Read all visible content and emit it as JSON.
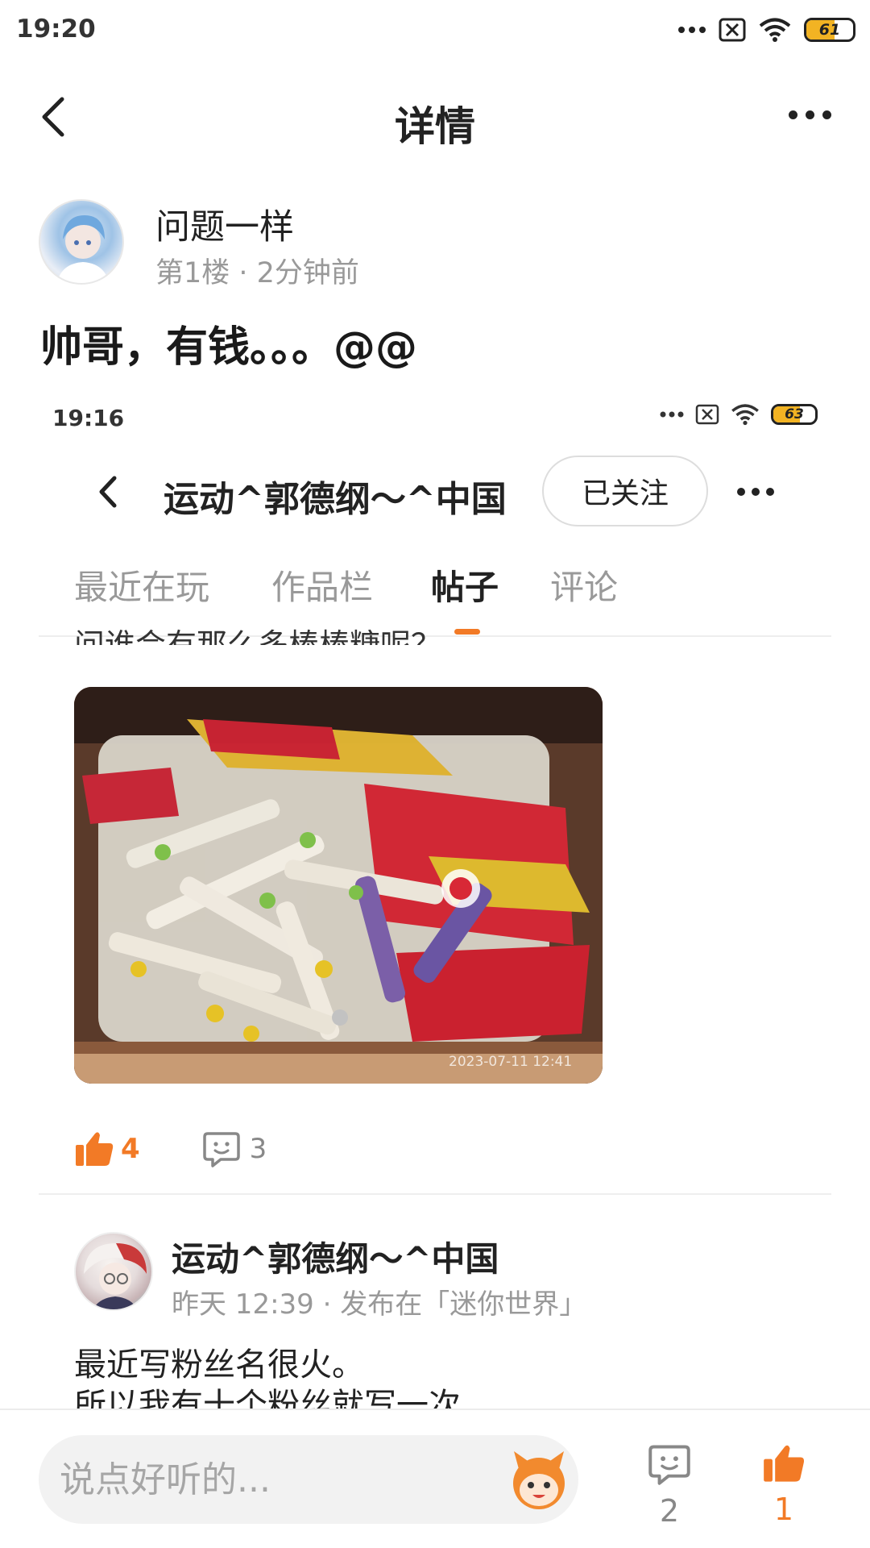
{
  "status_bar": {
    "time": "19:20",
    "battery": "61",
    "battery_level": 0.61,
    "icons": [
      "more-dots-icon",
      "sim-off-icon",
      "wifi-icon",
      "battery-icon"
    ]
  },
  "header": {
    "title": "详情"
  },
  "post": {
    "author": "问题一样",
    "meta": "第1楼 · 2分钟前",
    "text": "帅哥，有钱。。。@@"
  },
  "embedded": {
    "status_bar": {
      "time": "19:16",
      "battery": "63",
      "battery_level": 0.63
    },
    "header": {
      "title": "运动^郭德纲～^中国",
      "follow_label": "已关注"
    },
    "tabs": [
      "最近在玩",
      "作品栏",
      "帖子",
      "评论"
    ],
    "active_tab": "帖子",
    "cut_text": "问谁会有那么多棒棒糖呢？",
    "photo_timestamp": "2023-07-11 12:41",
    "actions": {
      "likes": "4",
      "comments": "3"
    },
    "next_post": {
      "author": "运动^郭德纲～^中国",
      "meta": "昨天 12:39 · 发布在「迷你世界」",
      "text_lines": [
        "最近写粉丝名很火。",
        "所以我有十个粉丝就写一次"
      ]
    }
  },
  "bottom_bar": {
    "placeholder": "说点好听的...",
    "comment_count": "2",
    "like_count": "1"
  },
  "colors": {
    "accent": "#f27a26",
    "muted": "#999999",
    "text": "#1a1a1a"
  }
}
